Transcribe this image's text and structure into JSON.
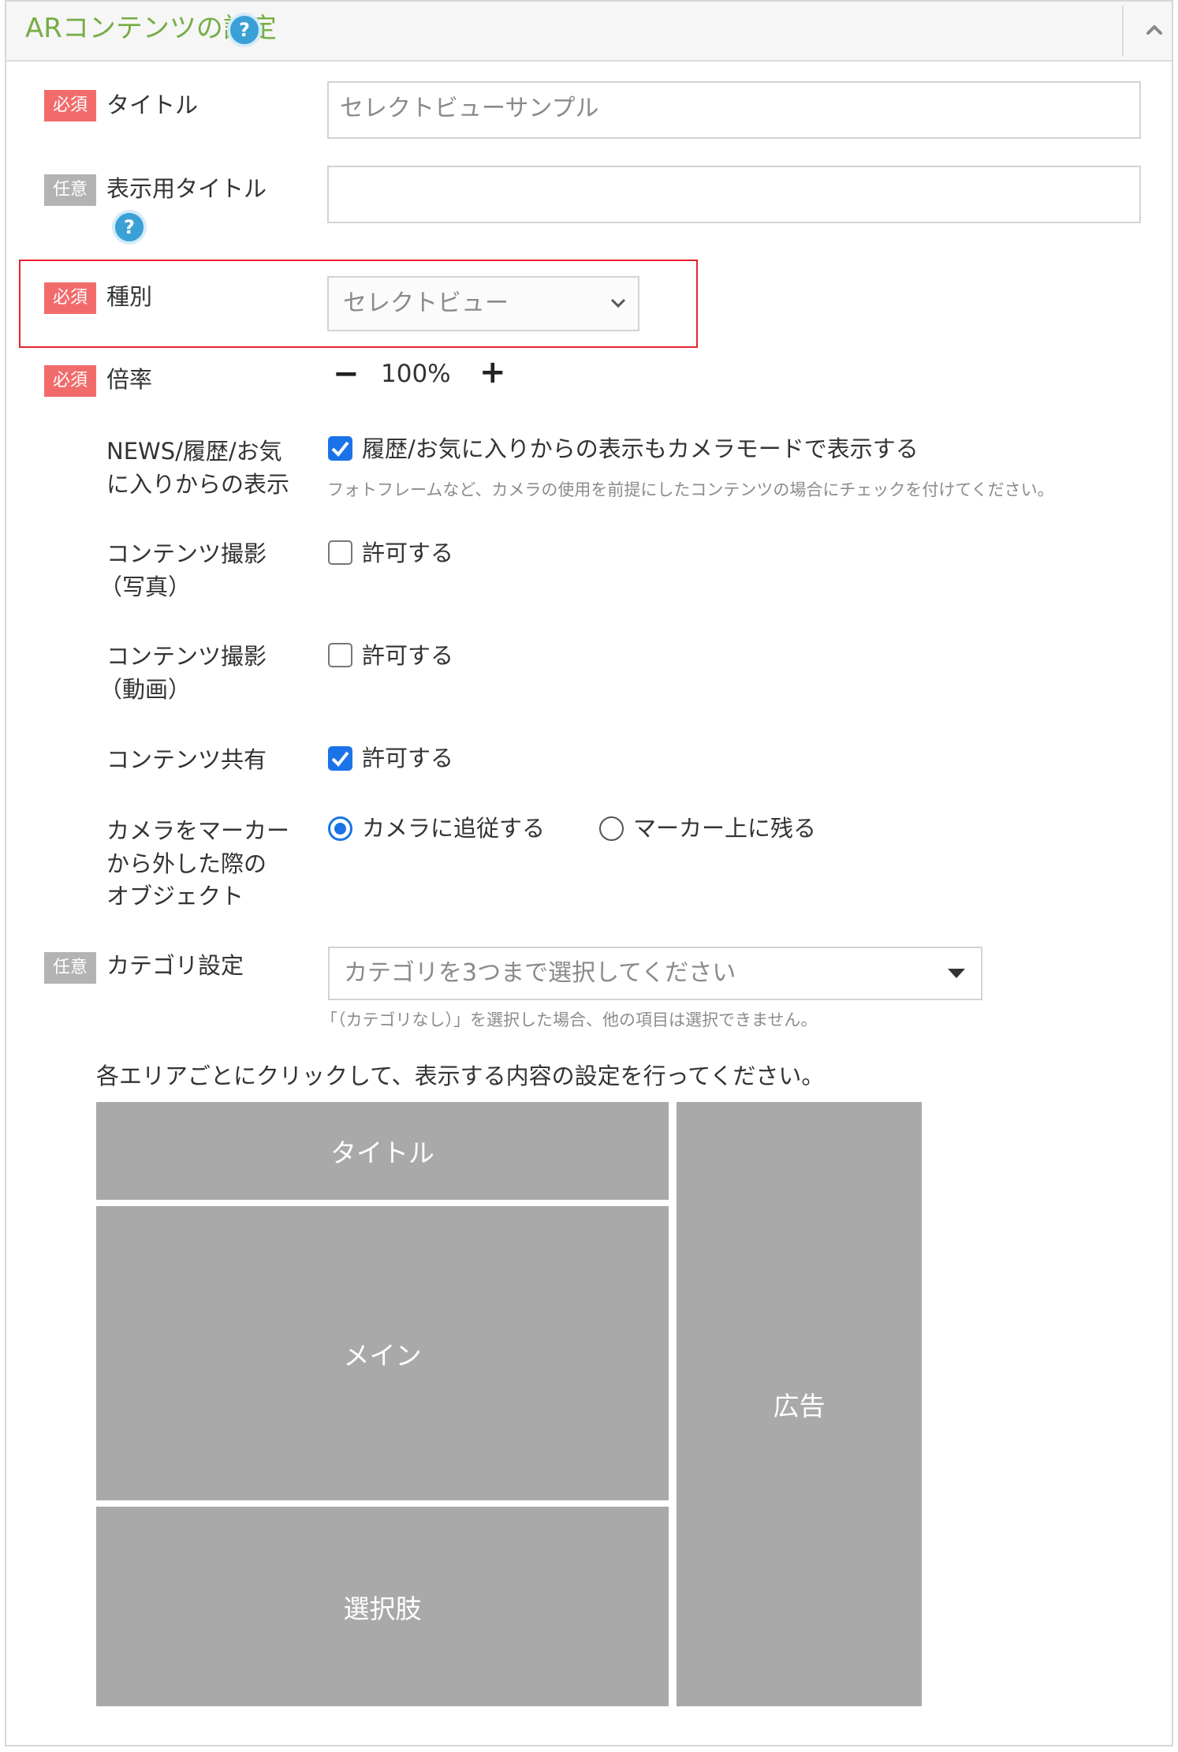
{
  "panel": {
    "title": "ARコンテンツの設定",
    "help_icon": "help-icon",
    "collapse_icon": "chevron-up-icon"
  },
  "badges": {
    "required": "必須",
    "optional": "任意"
  },
  "fields": {
    "title": {
      "label": "タイトル",
      "value": "セレクトビューサンプル"
    },
    "display_title": {
      "label": "表示用タイトル",
      "value": ""
    },
    "type": {
      "label": "種別",
      "value": "セレクトビュー"
    },
    "scale": {
      "label": "倍率",
      "value": "100%",
      "minus": "−",
      "plus": "+"
    },
    "news_history": {
      "label_line1": "NEWS/履歴/お気",
      "label_line2": "に入りからの表示",
      "option": "履歴/お気に入りからの表示もカメラモードで表示する",
      "checked": true,
      "hint": "フォトフレームなど、カメラの使用を前提にしたコンテンツの場合にチェックを付けてください。"
    },
    "photo_capture": {
      "label_line1": "コンテンツ撮影",
      "label_line2": "（写真）",
      "option": "許可する",
      "checked": false
    },
    "video_capture": {
      "label_line1": "コンテンツ撮影",
      "label_line2": "（動画）",
      "option": "許可する",
      "checked": false
    },
    "share": {
      "label": "コンテンツ共有",
      "option": "許可する",
      "checked": true
    },
    "marker_behavior": {
      "label_line1": "カメラをマーカー",
      "label_line2": "から外した際の",
      "label_line3": "オブジェクト",
      "options": [
        "カメラに追従する",
        "マーカー上に残る"
      ],
      "selected": 0
    },
    "category": {
      "label": "カテゴリ設定",
      "placeholder": "カテゴリを3つまで選択してください",
      "hint": "「（カテゴリなし）」を選択した場合、他の項目は選択できません。"
    }
  },
  "layout_editor": {
    "instruction": "各エリアごとにクリックして、表示する内容の設定を行ってください。",
    "areas": {
      "title": "タイトル",
      "main": "メイン",
      "choices": "選択肢",
      "ad": "広告"
    }
  },
  "colors": {
    "title_green": "#76ad45",
    "required_badge": "#f26b6b",
    "optional_badge": "#b3b3b3",
    "highlight_border": "#e8212a",
    "checkbox_blue": "#1a73e8",
    "area_gray": "#a9a9a9"
  }
}
